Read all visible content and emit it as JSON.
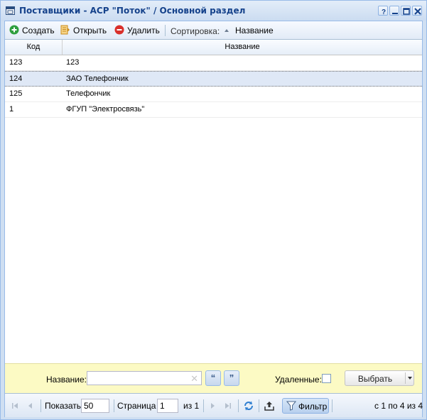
{
  "window": {
    "title": "Поставщики - АСР \"Поток\" / Основной раздел",
    "buttons": [
      "help-button",
      "minimize-button",
      "maximize-button",
      "close-button"
    ]
  },
  "toolbar": {
    "create_label": "Создать",
    "open_label": "Открыть",
    "delete_label": "Удалить",
    "sort_label": "Сортировка:",
    "sort_field_label": "Название"
  },
  "grid": {
    "columns": [
      "Код",
      "Название"
    ],
    "rows": [
      {
        "code": "123",
        "name": "123",
        "selected": false
      },
      {
        "code": "124",
        "name": "ЗАО Телефончик",
        "selected": true
      },
      {
        "code": "125",
        "name": "Телефончик",
        "selected": false
      },
      {
        "code": "1",
        "name": "ФГУП \"Электросвязь\"",
        "selected": false
      }
    ]
  },
  "filter": {
    "name_label": "Название:",
    "name_value": "",
    "open_quote": "“",
    "close_quote": "”",
    "deleted_label": "Удаленные:",
    "deleted_checked": false,
    "select_label": "Выбрать"
  },
  "pager": {
    "show_label": "Показать",
    "page_size": "50",
    "page_label": "Страница",
    "page_value": "1",
    "of_pages": "из 1",
    "filter_label": "Фильтр",
    "summary": "с 1 по 4 из 4"
  },
  "colors": {
    "accent": "#15428b",
    "selected_row": "#dfe8f6",
    "filter_bg": "#fcfac4",
    "window_border": "#99bbe8"
  }
}
